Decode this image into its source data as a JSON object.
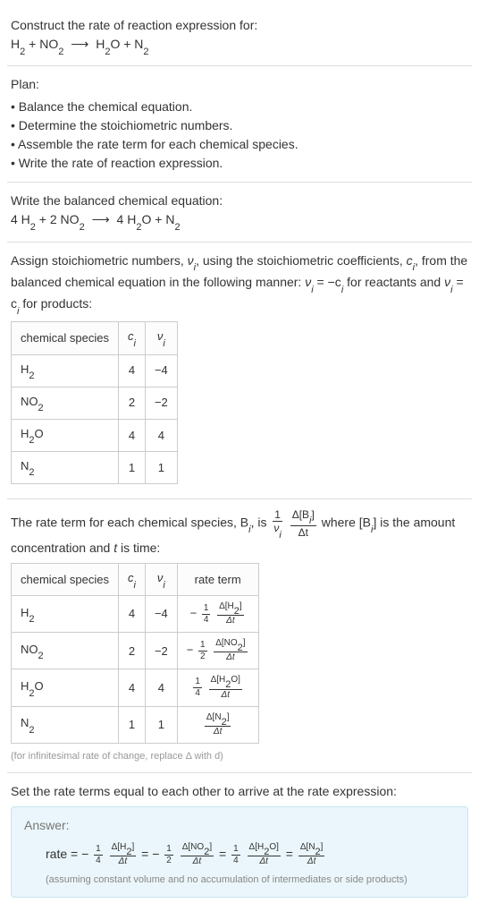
{
  "intro": {
    "prompt": "Construct the rate of reaction expression for:",
    "equation_left": "H",
    "equation_plus1": " + NO",
    "equation_arrow": "⟶",
    "equation_right1": "H",
    "equation_right2": "O + N"
  },
  "plan": {
    "title": "Plan:",
    "items": [
      "Balance the chemical equation.",
      "Determine the stoichiometric numbers.",
      "Assemble the rate term for each chemical species.",
      "Write the rate of reaction expression."
    ]
  },
  "balanced": {
    "title": "Write the balanced chemical equation:",
    "c1": "4 H",
    "c2": " + 2 NO",
    "arrow": "⟶",
    "c3": "4 H",
    "c4": "O + N"
  },
  "stoich": {
    "text_a": "Assign stoichiometric numbers, ",
    "nu": "ν",
    "text_b": ", using the stoichiometric coefficients, ",
    "c": "c",
    "text_c": ", from the balanced chemical equation in the following manner: ",
    "eq1_l": "ν",
    "eq1_r": " = −c",
    "text_d": " for reactants and ",
    "eq2_l": "ν",
    "eq2_r": " = c",
    "text_e": " for products:"
  },
  "table1": {
    "headers": [
      "chemical species",
      "c",
      "ν"
    ],
    "rows": [
      {
        "species": "H",
        "sub": "2",
        "c": "4",
        "nu": "−4"
      },
      {
        "species": "NO",
        "sub": "2",
        "c": "2",
        "nu": "−2"
      },
      {
        "species": "H",
        "sub": "2",
        "extra": "O",
        "c": "4",
        "nu": "4"
      },
      {
        "species": "N",
        "sub": "2",
        "c": "1",
        "nu": "1"
      }
    ]
  },
  "rateterm": {
    "text_a": "The rate term for each chemical species, B",
    "text_b": ", is ",
    "text_c": " where [B",
    "text_d": "] is the amount concentration and ",
    "t": "t",
    "text_e": " is time:",
    "one": "1",
    "nu_i": "ν",
    "delta_b": "Δ[B",
    "delta_b_close": "]",
    "delta_t": "Δt"
  },
  "table2": {
    "headers": [
      "chemical species",
      "c",
      "ν",
      "rate term"
    ],
    "rows": [
      {
        "species": "H",
        "sub": "2",
        "c": "4",
        "nu": "−4",
        "sign": "−",
        "fnum": "1",
        "fden": "4",
        "dnum": "Δ[H",
        "dsub": "2",
        "dclose": "]",
        "dden": "Δt"
      },
      {
        "species": "NO",
        "sub": "2",
        "c": "2",
        "nu": "−2",
        "sign": "−",
        "fnum": "1",
        "fden": "2",
        "dnum": "Δ[NO",
        "dsub": "2",
        "dclose": "]",
        "dden": "Δt"
      },
      {
        "species": "H",
        "sub": "2",
        "extra": "O",
        "c": "4",
        "nu": "4",
        "sign": "",
        "fnum": "1",
        "fden": "4",
        "dnum": "Δ[H",
        "dsub": "2",
        "dextra": "O",
        "dclose": "]",
        "dden": "Δt"
      },
      {
        "species": "N",
        "sub": "2",
        "c": "1",
        "nu": "1",
        "sign": "",
        "fnum": "",
        "fden": "",
        "dnum": "Δ[N",
        "dsub": "2",
        "dclose": "]",
        "dden": "Δt"
      }
    ],
    "caption": "(for infinitesimal rate of change, replace Δ with d)"
  },
  "final": {
    "title": "Set the rate terms equal to each other to arrive at the rate expression:"
  },
  "answer": {
    "label": "Answer:",
    "rate": "rate = ",
    "neg": "−",
    "eq": " = ",
    "f1n": "1",
    "f1d": "4",
    "d1n": "Δ[H",
    "d1s": "2",
    "d1c": "]",
    "dd": "Δt",
    "f2n": "1",
    "f2d": "2",
    "d2n": "Δ[NO",
    "d2s": "2",
    "d2c": "]",
    "f3n": "1",
    "f3d": "4",
    "d3n": "Δ[H",
    "d3s": "2",
    "d3e": "O",
    "d3c": "]",
    "d4n": "Δ[N",
    "d4s": "2",
    "d4c": "]",
    "note": "(assuming constant volume and no accumulation of intermediates or side products)"
  },
  "i": "i",
  "two": "2"
}
